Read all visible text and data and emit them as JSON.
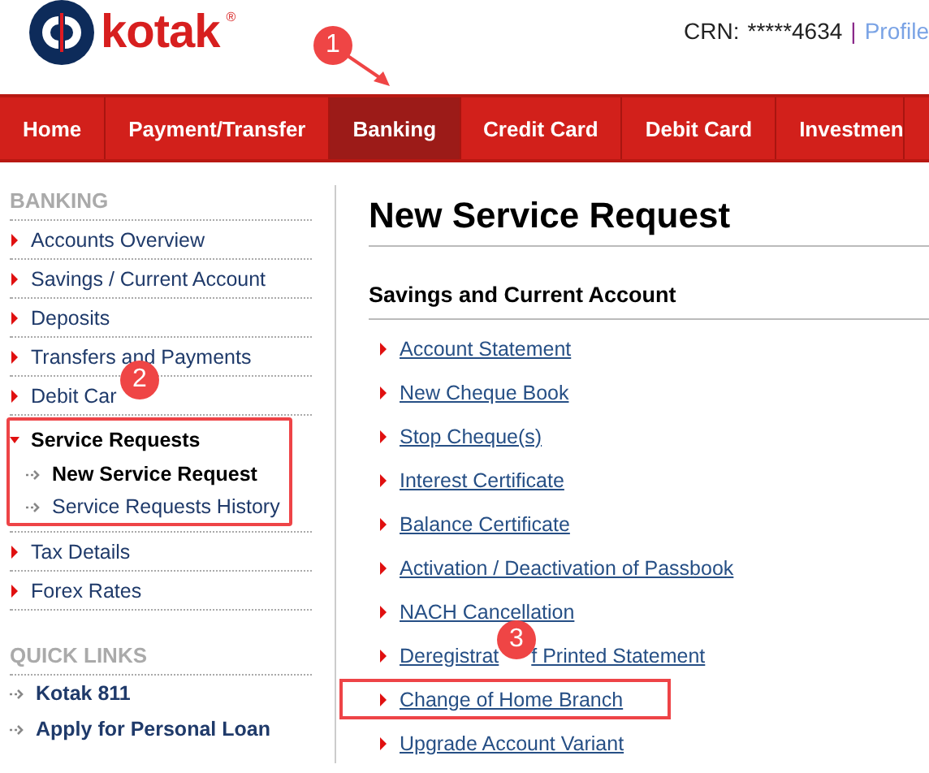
{
  "header": {
    "logo_text": "kotak",
    "logo_mark": "®",
    "crn_label": "CRN:",
    "crn_value": "*****4634",
    "separator": "|",
    "profile_link": "Profile",
    "callout": "1"
  },
  "nav": [
    {
      "label": "Home",
      "selected": false
    },
    {
      "label": "Payment/Transfer",
      "selected": false
    },
    {
      "label": "Banking",
      "selected": true
    },
    {
      "label": "Credit Card",
      "selected": false
    },
    {
      "label": "Debit Card",
      "selected": false
    },
    {
      "label": "Investmen",
      "selected": false
    }
  ],
  "sidebar": [
    {
      "title": "BANKING",
      "kind": "menu",
      "items": [
        {
          "label": "Accounts Overview",
          "expanded": false,
          "highlighted": false
        },
        {
          "label": "Savings / Current Account",
          "expanded": false,
          "highlighted": false
        },
        {
          "label": "Deposits",
          "expanded": false,
          "highlighted": false
        },
        {
          "label": "Transfers and Payments",
          "expanded": false,
          "highlighted": false
        },
        {
          "label": "Debit Car",
          "expanded": false,
          "highlighted": false,
          "badge": "2"
        },
        {
          "label": "Service Requests",
          "expanded": true,
          "highlighted": true,
          "children": [
            {
              "label": "New Service Request",
              "selected": true
            },
            {
              "label": "Service Requests History",
              "selected": false
            }
          ]
        },
        {
          "label": "Tax Details",
          "expanded": false,
          "highlighted": false
        },
        {
          "label": "Forex Rates",
          "expanded": false,
          "highlighted": false
        }
      ]
    },
    {
      "title": "QUICK LINKS",
      "kind": "links",
      "items": [
        {
          "label": "Kotak 811"
        },
        {
          "label": "Apply for Personal Loan"
        }
      ]
    }
  ],
  "content": {
    "title": "New Service Request",
    "section": "Savings and Current Account",
    "links": [
      {
        "label": "Account Statement",
        "highlighted": false
      },
      {
        "label": "New Cheque Book",
        "highlighted": false
      },
      {
        "label": "Stop Cheque(s)",
        "highlighted": false
      },
      {
        "label": "Interest Certificate",
        "highlighted": false
      },
      {
        "label": "Balance Certificate",
        "highlighted": false
      },
      {
        "label": "Activation / Deactivation of Passbook",
        "highlighted": false
      },
      {
        "label": "NACH Cancellation",
        "highlighted": false
      },
      {
        "label": "Deregistrat",
        "label_after": "f Printed Statement",
        "highlighted": false,
        "badge": "3"
      },
      {
        "label": "Change of Home Branch",
        "highlighted": true
      },
      {
        "label": "Upgrade Account Variant",
        "highlighted": false
      }
    ]
  }
}
